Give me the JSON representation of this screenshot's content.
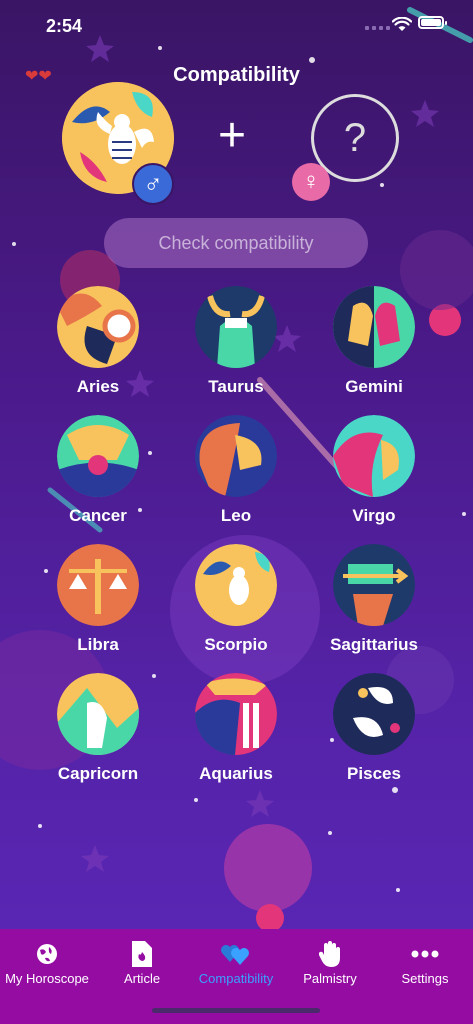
{
  "status_bar": {
    "time": "2:54"
  },
  "header": {
    "title": "Compatibility"
  },
  "selection": {
    "left_gender_symbol": "♂",
    "right_gender_symbol": "♀",
    "plus": "+",
    "unknown_symbol": "?"
  },
  "check_button": {
    "label": "Check compatibility"
  },
  "signs": [
    {
      "name": "Aries"
    },
    {
      "name": "Taurus"
    },
    {
      "name": "Gemini"
    },
    {
      "name": "Cancer"
    },
    {
      "name": "Leo"
    },
    {
      "name": "Virgo"
    },
    {
      "name": "Libra"
    },
    {
      "name": "Scorpio"
    },
    {
      "name": "Sagittarius"
    },
    {
      "name": "Capricorn"
    },
    {
      "name": "Aquarius"
    },
    {
      "name": "Pisces"
    }
  ],
  "tabs": [
    {
      "label": "My Horoscope",
      "icon": "globe-icon"
    },
    {
      "label": "Article",
      "icon": "document-icon"
    },
    {
      "label": "Compatibility",
      "icon": "hearts-icon",
      "active": true
    },
    {
      "label": "Palmistry",
      "icon": "hand-icon"
    },
    {
      "label": "Settings",
      "icon": "more-icon"
    }
  ],
  "colors": {
    "tab_bar": "#940ca2",
    "active_tab": "#3aa1ff",
    "male_badge": "#3a6ad8",
    "female_badge": "#e86aa7"
  }
}
